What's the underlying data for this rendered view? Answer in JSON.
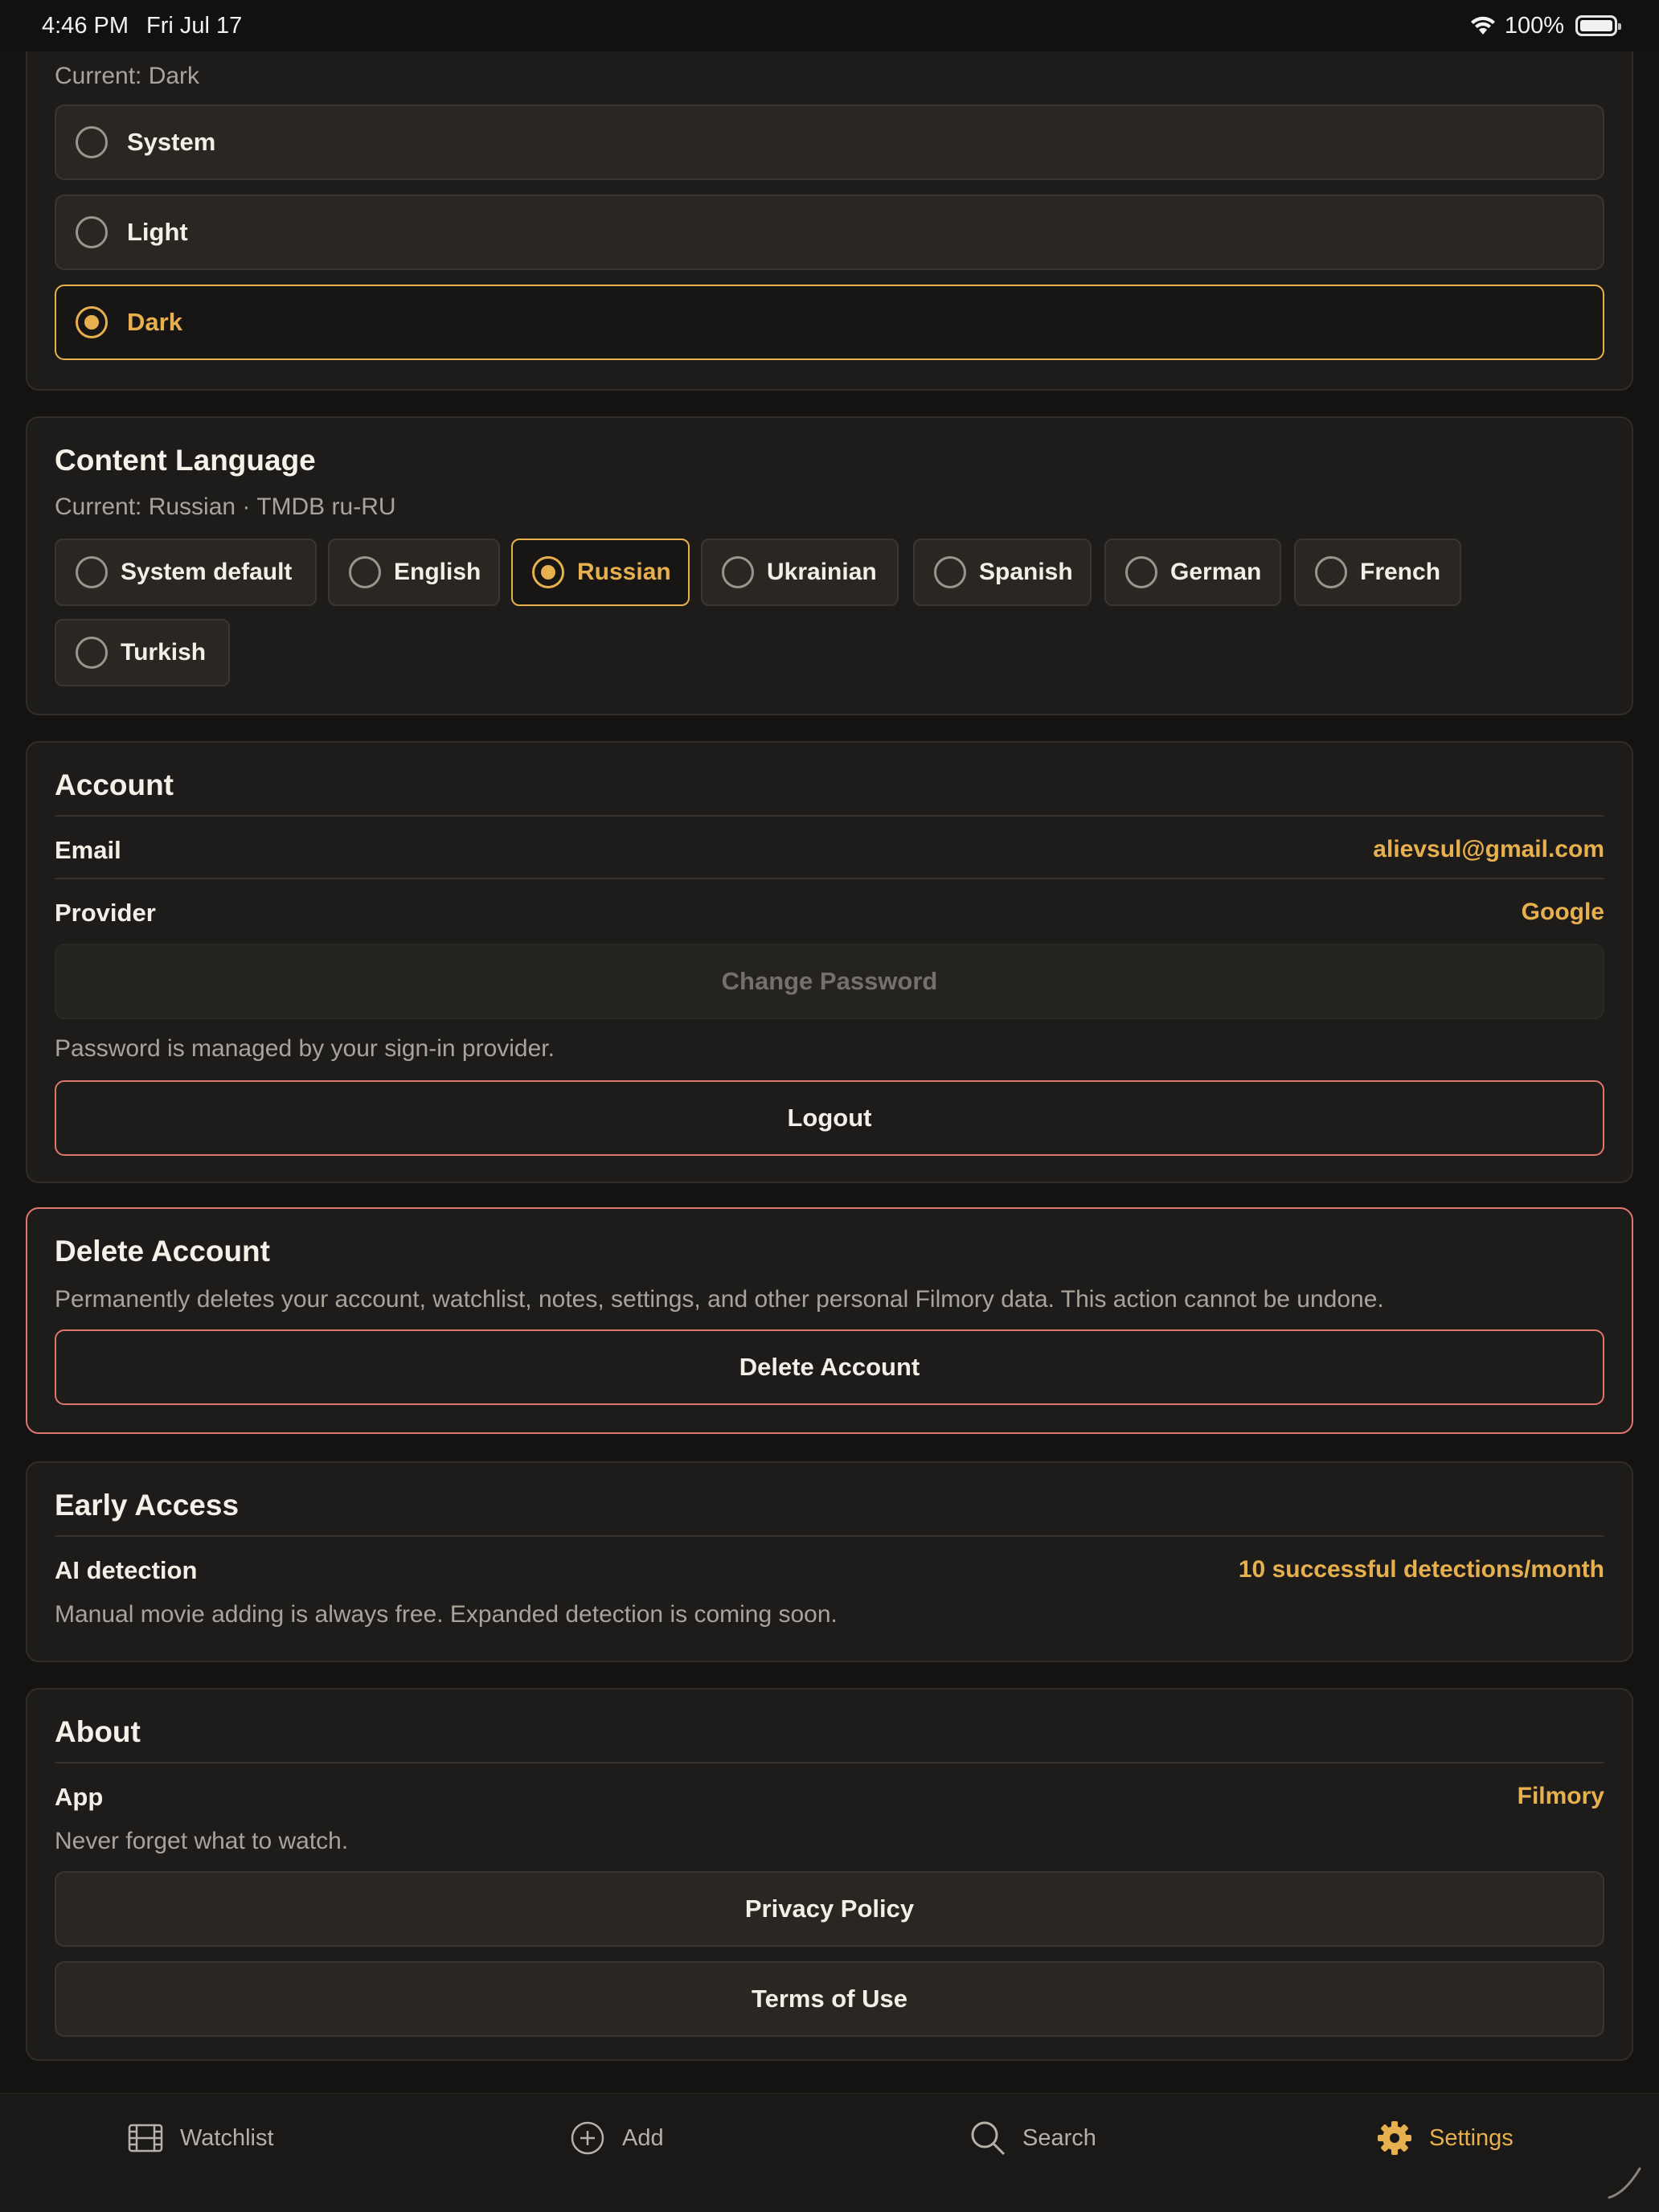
{
  "status_bar": {
    "time": "4:46 PM",
    "date": "Fri Jul 17",
    "battery": "100%"
  },
  "appearance": {
    "current": "Current: Dark",
    "options": [
      {
        "label": "System",
        "selected": false
      },
      {
        "label": "Light",
        "selected": false
      },
      {
        "label": "Dark",
        "selected": true
      }
    ]
  },
  "content_language": {
    "title": "Content Language",
    "current": "Current: Russian · TMDB ru-RU",
    "options": [
      {
        "label": "System default",
        "selected": false
      },
      {
        "label": "English",
        "selected": false
      },
      {
        "label": "Russian",
        "selected": true
      },
      {
        "label": "Ukrainian",
        "selected": false
      },
      {
        "label": "Spanish",
        "selected": false
      },
      {
        "label": "German",
        "selected": false
      },
      {
        "label": "French",
        "selected": false
      },
      {
        "label": "Turkish",
        "selected": false
      }
    ]
  },
  "account": {
    "title": "Account",
    "email_label": "Email",
    "email_value": "alievsul@gmail.com",
    "provider_label": "Provider",
    "provider_value": "Google",
    "change_password": "Change Password",
    "password_note": "Password is managed by your sign-in provider.",
    "logout": "Logout"
  },
  "delete_account": {
    "title": "Delete Account",
    "description": "Permanently deletes your account, watchlist, notes, settings, and other personal Filmory data. This action cannot be undone.",
    "button": "Delete Account"
  },
  "early_access": {
    "title": "Early Access",
    "ai_label": "AI detection",
    "ai_value": "10 successful detections/month",
    "note": "Manual movie adding is always free. Expanded detection is coming soon."
  },
  "about": {
    "title": "About",
    "app_label": "App",
    "app_value": "Filmory",
    "tagline": "Never forget what to watch.",
    "privacy": "Privacy Policy",
    "terms": "Terms of Use"
  },
  "tab_bar": {
    "tabs": [
      {
        "label": "Watchlist",
        "icon": "film-icon",
        "active": false
      },
      {
        "label": "Add",
        "icon": "plus-circle-icon",
        "active": false
      },
      {
        "label": "Search",
        "icon": "search-icon",
        "active": false
      },
      {
        "label": "Settings",
        "icon": "gear-icon",
        "active": true
      }
    ]
  },
  "colors": {
    "accent": "#e7b04e",
    "danger": "#e07570",
    "background": "#141312",
    "card": "#1e1c1a"
  }
}
